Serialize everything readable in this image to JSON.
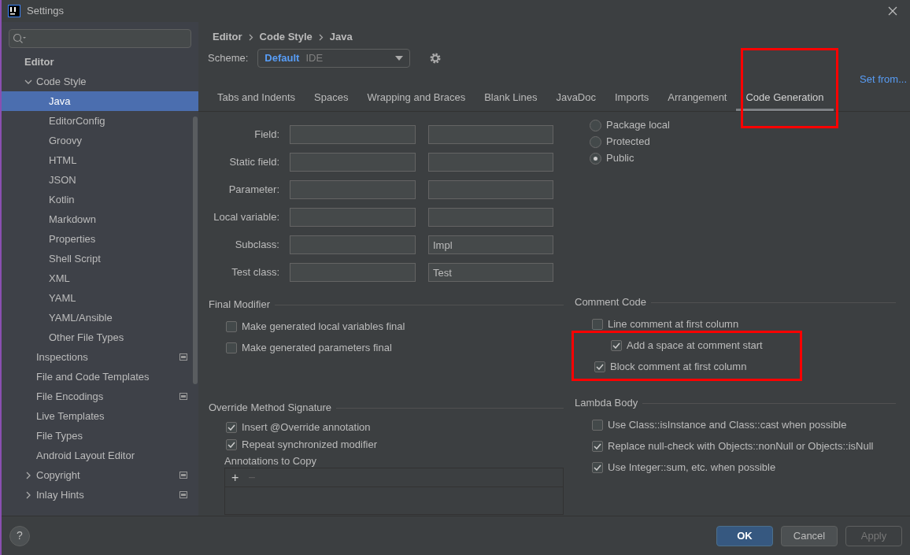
{
  "window": {
    "title": "Settings"
  },
  "sidebar": {
    "items": [
      {
        "label": "Editor",
        "kind": "header",
        "children": [
          {
            "label": "Code Style",
            "expanded": true,
            "selected": false,
            "children": [
              {
                "label": "Java",
                "selected": true
              },
              {
                "label": "EditorConfig",
                "selected": false
              },
              {
                "label": "Groovy",
                "selected": false
              },
              {
                "label": "HTML",
                "selected": false
              },
              {
                "label": "JSON",
                "selected": false
              },
              {
                "label": "Kotlin",
                "selected": false
              },
              {
                "label": "Markdown",
                "selected": false
              },
              {
                "label": "Properties",
                "selected": false
              },
              {
                "label": "Shell Script",
                "selected": false
              },
              {
                "label": "XML",
                "selected": false
              },
              {
                "label": "YAML",
                "selected": false
              },
              {
                "label": "YAML/Ansible",
                "selected": false
              },
              {
                "label": "Other File Types",
                "selected": false
              }
            ]
          },
          {
            "label": "Inspections",
            "selected": false,
            "project_level": true
          },
          {
            "label": "File and Code Templates",
            "selected": false
          },
          {
            "label": "File Encodings",
            "selected": false,
            "project_level": true
          },
          {
            "label": "Live Templates",
            "selected": false
          },
          {
            "label": "File Types",
            "selected": false
          },
          {
            "label": "Android Layout Editor",
            "selected": false
          },
          {
            "label": "Copyright",
            "selected": false,
            "expanded": false,
            "project_level": true
          },
          {
            "label": "Inlay Hints",
            "selected": false,
            "expanded": false,
            "project_level": true
          }
        ]
      }
    ]
  },
  "breadcrumb": [
    "Editor",
    "Code Style",
    "Java"
  ],
  "scheme": {
    "label": "Scheme:",
    "name": "Default",
    "tag": "IDE"
  },
  "set_from": "Set from...",
  "tabs": [
    {
      "label": "Tabs and Indents",
      "selected": false,
      "highlighted": false
    },
    {
      "label": "Spaces",
      "selected": false,
      "highlighted": false
    },
    {
      "label": "Wrapping and Braces",
      "selected": false,
      "highlighted": false
    },
    {
      "label": "Blank Lines",
      "selected": false,
      "highlighted": false
    },
    {
      "label": "JavaDoc",
      "selected": false,
      "highlighted": false
    },
    {
      "label": "Imports",
      "selected": false,
      "highlighted": false
    },
    {
      "label": "Arrangement",
      "selected": false,
      "highlighted": false
    },
    {
      "label": "Code Generation",
      "selected": true,
      "highlighted": true
    }
  ],
  "naming": [
    {
      "label": "Field:"
    },
    {
      "label": "Static field:"
    },
    {
      "label": "Parameter:"
    },
    {
      "label": "Local variable:"
    },
    {
      "label": "Subclass:",
      "suffix": "Impl"
    },
    {
      "label": "Test class:",
      "suffix": "Test"
    }
  ],
  "visibility": [
    {
      "label": "Package local",
      "selected": false
    },
    {
      "label": "Protected",
      "selected": false
    },
    {
      "label": "Public",
      "selected": true
    }
  ],
  "final_modifier": {
    "title": "Final Modifier",
    "options": [
      {
        "label": "Make generated local variables final",
        "checked": false
      },
      {
        "label": "Make generated parameters final",
        "checked": false
      }
    ]
  },
  "comment_code": {
    "title": "Comment Code",
    "options": [
      {
        "label": "Line comment at first column",
        "checked": false,
        "indented": false,
        "highlighted": false
      },
      {
        "label": "Add a space at comment start",
        "checked": true,
        "indented": true,
        "highlighted": true
      },
      {
        "label": "Block comment at first column",
        "checked": true,
        "indented": false,
        "highlighted": true
      }
    ]
  },
  "override": {
    "title": "Override Method Signature",
    "options": [
      {
        "label": "Insert @Override annotation",
        "checked": true
      },
      {
        "label": "Repeat synchronized modifier",
        "checked": true
      }
    ],
    "annotations_label": "Annotations to Copy",
    "add": "+",
    "remove": "−"
  },
  "lambda": {
    "title": "Lambda Body",
    "options": [
      {
        "label": "Use Class::isInstance and Class::cast when possible",
        "checked": false
      },
      {
        "label": "Replace null-check with Objects::nonNull or Objects::isNull",
        "checked": true
      },
      {
        "label": "Use Integer::sum, etc. when possible",
        "checked": true
      }
    ]
  },
  "help": "?",
  "buttons": [
    {
      "label": "OK",
      "kind": "primary"
    },
    {
      "label": "Cancel",
      "kind": "normal"
    },
    {
      "label": "Apply",
      "kind": "disabled"
    }
  ]
}
